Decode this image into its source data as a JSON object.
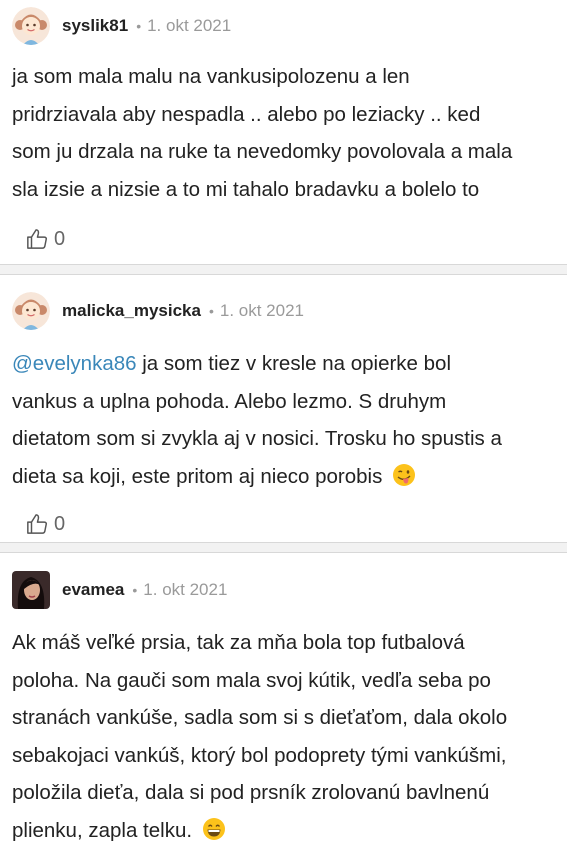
{
  "comments": [
    {
      "username": "syslik81",
      "date": "1. okt 2021",
      "avatar_icon": "girl-avatar-icon",
      "lines": [
        "ja som mala malu na vankusipolozenu a len",
        "pridrziavala aby nespadla .. alebo po leziacky .. ked",
        "som ju drzala na ruke ta nevedomky povolovala a mala",
        "sla izsie a nizsie a to mi tahalo bradavku a bolelo to"
      ],
      "likes": "0"
    },
    {
      "username": "malicka_mysicka",
      "date": "1. okt 2021",
      "avatar_icon": "girl-avatar-icon",
      "mention": "@evelynka86",
      "line1_rest": " ja som tiez v kresle na opierke bol",
      "lines": [
        "vankus a uplna pohoda. Alebo lezmo. S druhym",
        "dietatom som si zvykla aj v nosici. Trosku ho spustis a",
        "dieta sa koji, este pritom aj nieco porobis"
      ],
      "emoji": "winking-tongue-emoji",
      "likes": "0"
    },
    {
      "username": "evamea",
      "date": "1. okt 2021",
      "avatar_icon": "photo-avatar",
      "lines": [
        "Ak máš veľké prsia, tak za mňa bola top futbalová",
        "poloha. Na gauči som mala svoj kútik, vedľa seba po",
        "stranách vankúše, sadla som si s dieťaťom, dala okolo",
        "sebakojaci vankúš, ktorý bol podoprety tými vankúšmi,",
        "položila dieťa, dala si pod prsník zrolovanú bavlnenú",
        "plienku, zapla telku."
      ],
      "emoji": "grinning-emoji"
    }
  ],
  "header_separator": "•",
  "colors": {
    "mention": "#3a87b9",
    "meta": "#9a9a9a",
    "separator_bg": "#f2f2f2"
  }
}
